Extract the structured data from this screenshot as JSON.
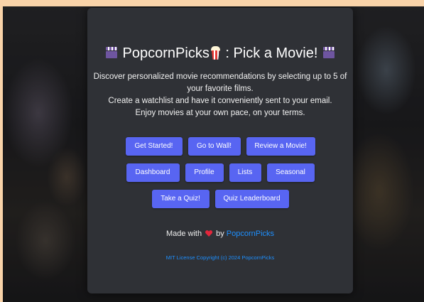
{
  "header": {
    "title": "PopcornPicks",
    "title_suffix": " : Pick a Movie!",
    "left_icon": "clapper-board-icon",
    "popcorn_icon": "popcorn-icon",
    "right_icon": "clapper-board-icon"
  },
  "description": {
    "line1": "Discover personalized movie recommendations by selecting up to 5 of",
    "line2": "your favorite films.",
    "line3": "Create a watchlist and have it conveniently sent to your email.",
    "line4": "Enjoy movies at your own pace, on your terms."
  },
  "buttons": {
    "get_started": "Get Started!",
    "go_to_wall": "Go to Wall!",
    "review_movie": "Review a Movie!",
    "dashboard": "Dashboard",
    "profile": "Profile",
    "lists": "Lists",
    "seasonal": "Seasonal",
    "take_quiz": "Take a Quiz!",
    "quiz_leaderboard": "Quiz Leaderboard"
  },
  "footer": {
    "made_with": "Made with",
    "by": "by",
    "author_link": "PopcornPicks",
    "heart_icon": "heart-icon",
    "license": "MIT License Copyright (c) 2024 PopcornPicks"
  },
  "colors": {
    "page_background": "#f9d3a9",
    "card_background": "#2f3136",
    "button": "#5865f2",
    "link": "#1e90ff",
    "heart": "#e3263b"
  }
}
